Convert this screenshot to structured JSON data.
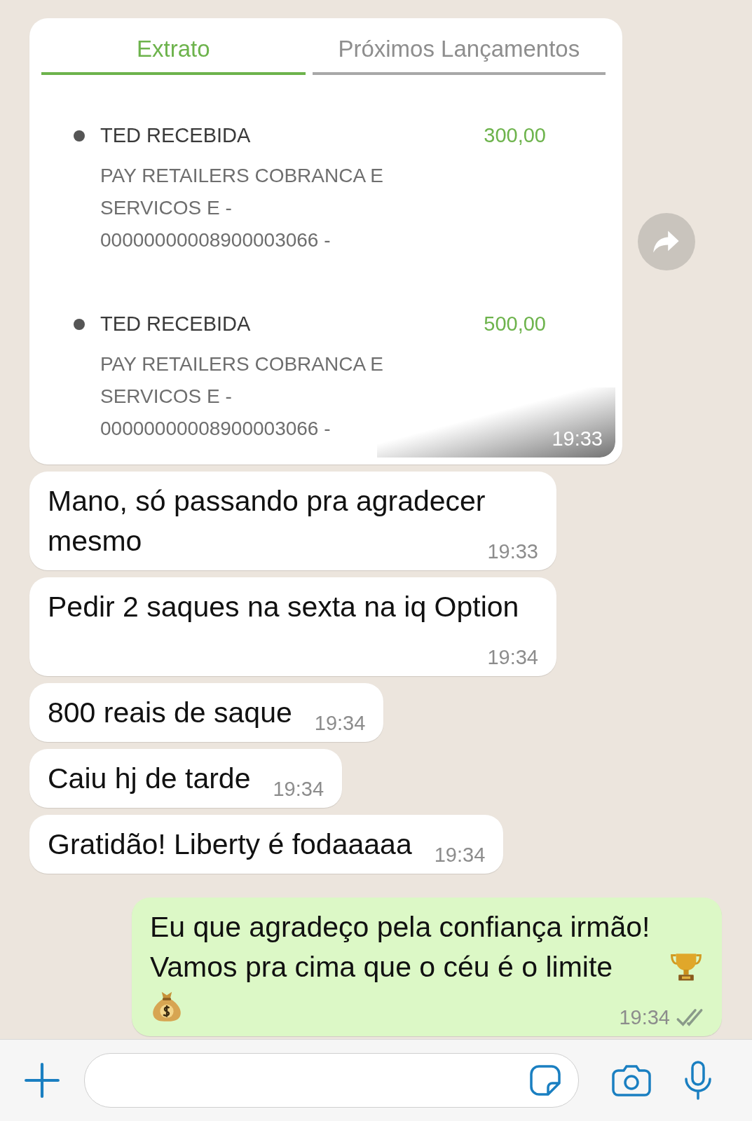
{
  "statement_message": {
    "tabs": [
      {
        "label": "Extrato",
        "selected": true
      },
      {
        "label": "Próximos Lançamentos",
        "selected": false
      }
    ],
    "transactions": [
      {
        "title": "TED RECEBIDA",
        "amount": "300,00",
        "description_lines": [
          "PAY RETAILERS COBRANCA E",
          "SERVICOS E -",
          "00000000008900003066 -"
        ]
      },
      {
        "title": "TED RECEBIDA",
        "amount": "500,00",
        "description_lines": [
          "PAY RETAILERS COBRANCA E",
          "SERVICOS E -",
          "00000000008900003066 -"
        ]
      }
    ],
    "time": "19:33"
  },
  "messages": [
    {
      "kind": "incoming",
      "text": "Mano, só passando pra agradecer mesmo",
      "time": "19:33"
    },
    {
      "kind": "incoming",
      "text": "Pedir 2 saques na sexta na iq Option",
      "time": "19:34"
    },
    {
      "kind": "incoming",
      "text": "800 reais de saque",
      "time": "19:34"
    },
    {
      "kind": "incoming",
      "text": "Caiu hj de tarde",
      "time": "19:34"
    },
    {
      "kind": "incoming",
      "text": "Gratidão! Liberty é fodaaaaa",
      "time": "19:34"
    },
    {
      "kind": "outgoing",
      "text": "Eu que agradeço pela confiança irmão! Vamos pra cima que o céu é o limite",
      "emojis": [
        {
          "kind": "trophy"
        },
        {
          "kind": "money_bag"
        }
      ],
      "time": "19:34",
      "read": false
    }
  ]
}
